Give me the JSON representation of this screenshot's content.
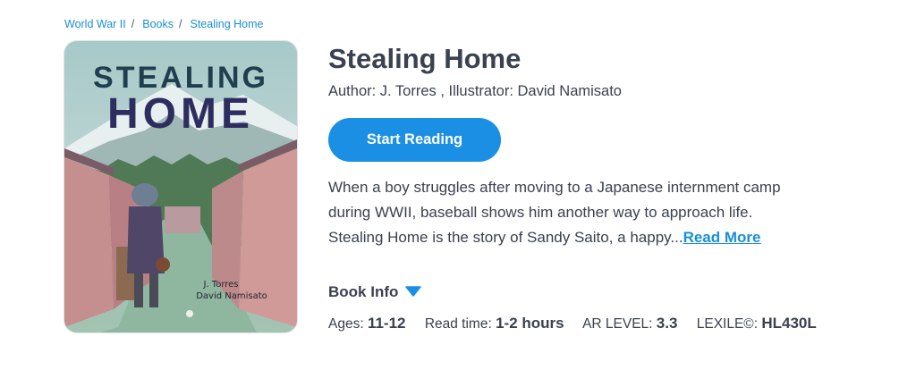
{
  "breadcrumb": {
    "items": [
      "World War II",
      "Books",
      "Stealing Home"
    ],
    "separator": "/"
  },
  "cover": {
    "title_line1": "STEALING",
    "title_line2": "HOME",
    "author1": "J. Torres",
    "author2": "David Namisato"
  },
  "book": {
    "title": "Stealing Home",
    "authors": "Author: J. Torres , Illustrator: David Namisato",
    "start_label": "Start Reading",
    "description_1": "When a boy struggles after moving to a Japanese internment camp during WWII, baseball shows him another way to approach life.",
    "description_2": "Stealing Home is the story of Sandy Saito, a happy...",
    "read_more": "Read More",
    "info_label": "Book Info"
  },
  "meta": {
    "ages_label": "Ages:",
    "ages": "11-12",
    "read_time_label": "Read time:",
    "read_time": "1-2 hours",
    "ar_label": "AR LEVEL:",
    "ar": "3.3",
    "lexile_label": "LEXILE©:",
    "lexile": "HL430L"
  },
  "colors": {
    "accent": "#1a8fe3",
    "link": "#1a8fd6",
    "text": "#3a4150",
    "cover_title": "#2d2d5f"
  },
  "icons": {
    "book_info_toggle": "caret-down-icon"
  }
}
